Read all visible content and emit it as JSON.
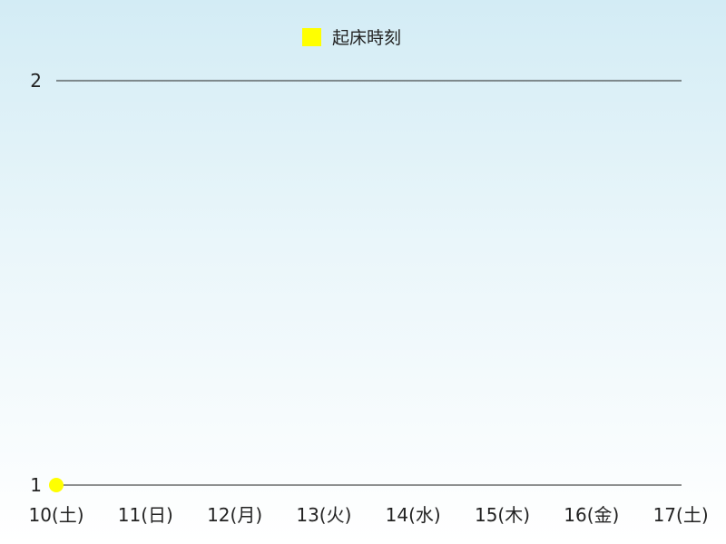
{
  "chart_data": {
    "type": "line",
    "title": "",
    "xlabel": "",
    "ylabel": "",
    "categories": [
      "10(土)",
      "11(日)",
      "12(月)",
      "13(火)",
      "14(水)",
      "15(木)",
      "16(金)",
      "17(土)"
    ],
    "yticks": [
      "1",
      "2"
    ],
    "ylim": [
      1,
      2
    ],
    "grid": true,
    "legend_position": "top-center",
    "series": [
      {
        "name": "起床時刻",
        "color": "#ffff00",
        "points": [
          {
            "x": "10(土)",
            "y": 1
          }
        ]
      }
    ]
  }
}
